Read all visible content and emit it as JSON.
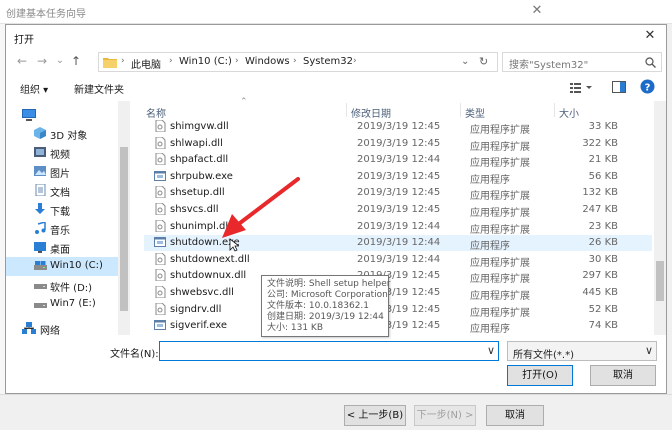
{
  "background_window": {
    "title": "创建基本任务向导",
    "close_glyph": "✕",
    "buttons": {
      "prev": "< 上一步(B)",
      "next": "下一步(N) >",
      "cancel": "取消"
    }
  },
  "dialog": {
    "title": "打开",
    "close_glyph": "✕",
    "nav": {
      "back": "←",
      "forward": "→",
      "recent": "⌄",
      "up": "↑"
    },
    "breadcrumb": [
      "此电脑",
      "Win10 (C:)",
      "Windows",
      "System32"
    ],
    "search_placeholder": "搜索\"System32\"",
    "toolbar": {
      "organize": "组织 ▾",
      "new_folder": "新建文件夹"
    },
    "tree": [
      {
        "label": "3D 对象",
        "icon": "3d-objects-icon"
      },
      {
        "label": "视频",
        "icon": "video-icon"
      },
      {
        "label": "图片",
        "icon": "pictures-icon"
      },
      {
        "label": "文档",
        "icon": "documents-icon"
      },
      {
        "label": "下载",
        "icon": "downloads-icon"
      },
      {
        "label": "音乐",
        "icon": "music-icon"
      },
      {
        "label": "桌面",
        "icon": "desktop-icon"
      },
      {
        "label": "Win10 (C:)",
        "icon": "drive-icon"
      },
      {
        "label": "软件 (D:)",
        "icon": "drive-icon"
      },
      {
        "label": "Win7 (E:)",
        "icon": "drive-icon"
      },
      {
        "label": "网络",
        "icon": "network-icon"
      }
    ],
    "columns": {
      "name": "名称",
      "date": "修改日期",
      "type": "类型",
      "size": "大小"
    },
    "files": [
      {
        "name": "shimgvw.dll",
        "date": "2019/3/19 12:45",
        "type": "应用程序扩展",
        "size": "33 KB"
      },
      {
        "name": "shlwapi.dll",
        "date": "2019/3/19 12:45",
        "type": "应用程序扩展",
        "size": "322 KB"
      },
      {
        "name": "shpafact.dll",
        "date": "2019/3/19 12:44",
        "type": "应用程序扩展",
        "size": "21 KB"
      },
      {
        "name": "shrpubw.exe",
        "date": "2019/3/19 12:45",
        "type": "应用程序",
        "size": "56 KB"
      },
      {
        "name": "shsetup.dll",
        "date": "2019/3/19 12:45",
        "type": "应用程序扩展",
        "size": "132 KB"
      },
      {
        "name": "shsvcs.dll",
        "date": "2019/3/19 12:45",
        "type": "应用程序扩展",
        "size": "247 KB"
      },
      {
        "name": "shunimpl.dll",
        "date": "2019/3/19 12:44",
        "type": "应用程序扩展",
        "size": "23 KB"
      },
      {
        "name": "shutdown.exe",
        "date": "2019/3/19 12:44",
        "type": "应用程序",
        "size": "26 KB"
      },
      {
        "name": "shutdownext.dll",
        "date": "2019/3/19 12:44",
        "type": "应用程序扩展",
        "size": "30 KB"
      },
      {
        "name": "shutdownux.dll",
        "date": "2019/3/19 12:45",
        "type": "应用程序扩展",
        "size": "297 KB"
      },
      {
        "name": "shwebsvc.dll",
        "date": "2019/3/19 12:45",
        "type": "应用程序扩展",
        "size": "445 KB"
      },
      {
        "name": "signdrv.dll",
        "date": "2019/3/19 12:45",
        "type": "应用程序扩展",
        "size": "52 KB"
      },
      {
        "name": "sigverif.exe",
        "date": "2019/3/19 12:45",
        "type": "应用程序",
        "size": "74 KB"
      }
    ],
    "tooltip": [
      "文件说明: Shell setup helper",
      "公司: Microsoft Corporation",
      "文件版本: 10.0.18362.1",
      "创建日期: 2019/3/19 12:44",
      "大小: 131 KB"
    ],
    "filename_label": "文件名(N):",
    "filename_value": "",
    "filetype": "所有文件(*.*)",
    "open_button": "打开(O)",
    "cancel_button": "取消"
  },
  "colors": {
    "accent": "#0078d7",
    "selection": "#cce8ff",
    "hover": "#e5f3ff",
    "annotation_arrow": "#e8282b"
  }
}
